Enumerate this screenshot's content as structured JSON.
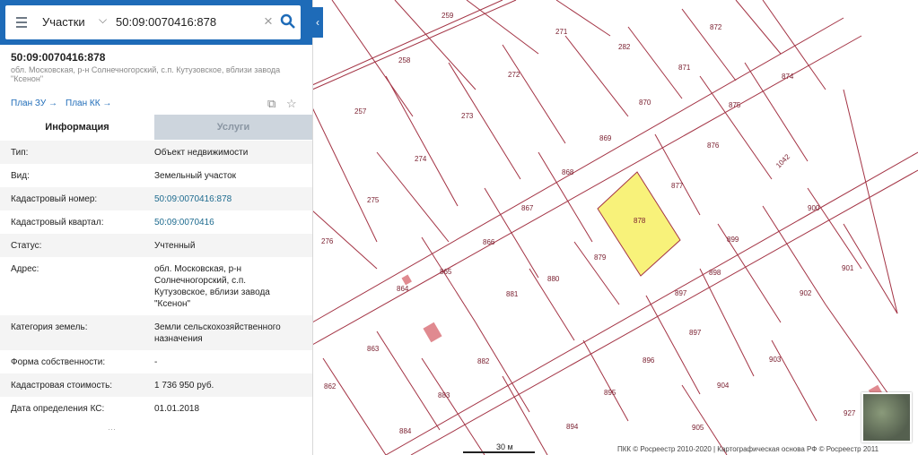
{
  "search": {
    "category": "Участки",
    "query": "50:09:0070416:878"
  },
  "parcel": {
    "title": "50:09:0070416:878",
    "address_line": "обл. Московская, р-н Солнечногорский, с.п. Кутузовское, вблизи завода \"Ксенон\""
  },
  "links": {
    "plan_zu": "План ЗУ →",
    "plan_kk": "План КК →"
  },
  "tabs": {
    "info": "Информация",
    "services": "Услуги"
  },
  "rows": [
    {
      "key": "Тип:",
      "value": "Объект недвижимости"
    },
    {
      "key": "Вид:",
      "value": "Земельный участок"
    },
    {
      "key": "Кадастровый номер:",
      "value": "50:09:0070416:878"
    },
    {
      "key": "Кадастровый квартал:",
      "value": "50:09:0070416"
    },
    {
      "key": "Статус:",
      "value": "Учтенный"
    },
    {
      "key": "Адрес:",
      "value": "обл. Московская, р-н Солнечногорский, с.п. Кутузовское, вблизи завода \"Ксенон\""
    },
    {
      "key": "Категория земель:",
      "value": "Земли сельскохозяйственного назначения"
    },
    {
      "key": "Форма собственности:",
      "value": "-"
    },
    {
      "key": "Кадастровая стоимость:",
      "value": "1 736 950 руб."
    },
    {
      "key": "Дата определения КС:",
      "value": "01.01.2018"
    }
  ],
  "map": {
    "parcels": [
      "259",
      "258",
      "271",
      "272",
      "282",
      "872",
      "871",
      "874",
      "875",
      "257",
      "273",
      "870",
      "869",
      "876",
      "274",
      "868",
      "877",
      "1042",
      "275",
      "867",
      "878",
      "900",
      "276",
      "866",
      "879",
      "899",
      "864",
      "865",
      "881",
      "880",
      "898",
      "901",
      "863",
      "897",
      "902",
      "882",
      "896",
      "897",
      "903",
      "862",
      "883",
      "895",
      "904",
      "905",
      "884",
      "894",
      "927"
    ],
    "scale_label": "30 м",
    "copyright": "ПКК © Росреестр 2010-2020 | Картографическая основа РФ © Росреестр 2011",
    "selected_color": "#f8f27a",
    "line_color": "#9b2335"
  }
}
